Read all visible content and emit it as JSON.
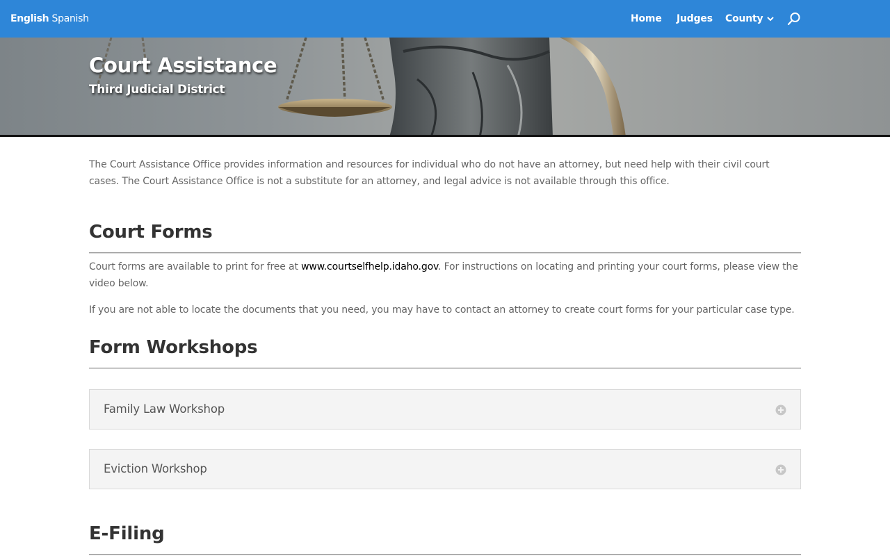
{
  "header": {
    "lang_active": "English",
    "lang_other": "Spanish",
    "nav": {
      "home": "Home",
      "judges": "Judges",
      "county": "County"
    },
    "icons": [
      "search-icon",
      "chevron-down-icon"
    ],
    "bar_color": "#2e86d8"
  },
  "hero": {
    "title": "Court Assistance",
    "subtitle": "Third Judicial District"
  },
  "intro": "The Court Assistance Office provides information and resources for individual who do not have an attorney, but need help with their civil court cases. The Court Assistance Office is not a substitute for an attorney, and legal advice is not available through this office.",
  "court_forms": {
    "title": "Court Forms",
    "p1_before": "Court forms are available to print for free at ",
    "p1_link": "www.courtselfhelp.idaho.gov",
    "p1_after": ". For instructions on locating and printing your court forms, please view the video below.",
    "p2": "If you are not able to locate the documents that you need, you may have to contact an attorney to create court forms for your particular case type."
  },
  "form_workshops": {
    "title": "Form Workshops",
    "toggles": [
      {
        "label": "Family Law Workshop",
        "icon": "plus-circle-icon"
      },
      {
        "label": "Eviction Workshop",
        "icon": "plus-circle-icon"
      }
    ]
  },
  "efiling": {
    "title": "E-Filing"
  }
}
